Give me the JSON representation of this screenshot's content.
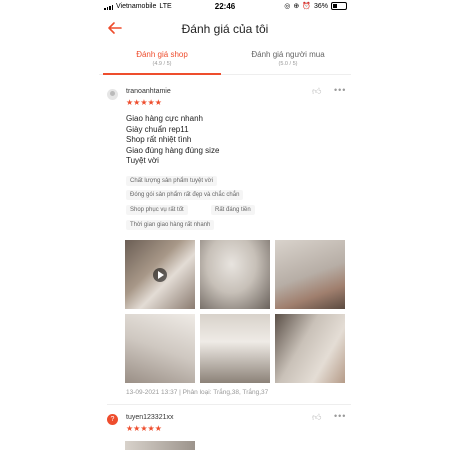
{
  "status": {
    "carrier": "Vietnamobile",
    "network": "LTE",
    "time": "22:46",
    "battery": "36%"
  },
  "header": {
    "title": "Đánh giá của tôi"
  },
  "tabs": [
    {
      "label": "Đánh giá shop",
      "score": "(4.9 / 5)",
      "active": true
    },
    {
      "label": "Đánh giá người mua",
      "score": "(5.0 / 5)",
      "active": false
    }
  ],
  "review1": {
    "username": "tranoanhtamie",
    "stars": "★★★★★",
    "text_lines": [
      "Giao hàng cực nhanh",
      "Giày chuẩn rep11",
      "Shop rất nhiệt tình",
      "Giao đúng hàng đúng size",
      "Tuyệt vời"
    ],
    "tags": [
      "Chất lượng sản phẩm tuyệt vời",
      "Đóng gói sản phẩm rất đẹp và chắc chắn",
      "Shop phục vụ rất tốt",
      "Rất đáng tiền",
      "Thời gian giao hàng rất nhanh"
    ],
    "meta": "13-09-2021 13:37 | Phân loại: Trắng,38, Trắng,37"
  },
  "review2": {
    "username": "tuyen123321xx",
    "stars": "★★★★★",
    "avatar_letter": "?"
  },
  "colors": {
    "accent": "#ee4d2d"
  }
}
